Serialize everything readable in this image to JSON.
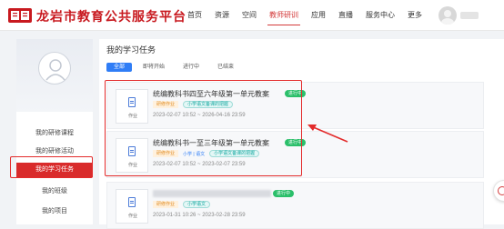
{
  "header": {
    "site_title": "龙岩市教育公共服务平台",
    "nav": [
      {
        "label": "首页"
      },
      {
        "label": "资源"
      },
      {
        "label": "空间"
      },
      {
        "label": "教师研训"
      },
      {
        "label": "应用"
      },
      {
        "label": "直播"
      },
      {
        "label": "服务中心"
      },
      {
        "label": "更多"
      }
    ],
    "active_nav": "教师研训",
    "accent_color": "#d33a3a",
    "icons": [
      "logo",
      "user-avatar"
    ]
  },
  "sidebar": {
    "items": [
      {
        "label": "我的研修课程"
      },
      {
        "label": "我的研修活动"
      },
      {
        "label": "我的学习任务"
      },
      {
        "label": "我的班级"
      },
      {
        "label": "我的项目"
      }
    ],
    "active_item": "我的学习任务",
    "active_color": "#d92b2b"
  },
  "main": {
    "title": "我的学习任务",
    "tabs": [
      {
        "label": "全部"
      },
      {
        "label": "即将开始"
      },
      {
        "label": "进行中"
      },
      {
        "label": "已结束"
      }
    ],
    "active_tab": "全部",
    "tab_active_color": "#2f7df6",
    "tasks": [
      {
        "thumb_label": "作业",
        "title": "统编教科书四至六年级第一单元教案",
        "status": "进行中",
        "type_tag": "研修作业",
        "subject_tag": "",
        "tag": "小学语文备课的把握",
        "date_range": "2023-02-07 10:52 ~ 2026-04-16 23:59"
      },
      {
        "thumb_label": "作业",
        "title": "统编教科书一至三年级第一单元教案",
        "status": "进行中",
        "type_tag": "研修作业",
        "subject_tag": "小学 | 语文",
        "tag": "小学语文备课的把握",
        "date_range": "2023-02-07 10:52 ~ 2023-02-07 23:59"
      },
      {
        "thumb_label": "作业",
        "title": "",
        "status": "进行中",
        "type_tag": "研修作业",
        "subject_tag": "",
        "tag": "小学语文",
        "date_range": "2023-01-31 10:26 ~ 2023-02-28 23:59"
      }
    ],
    "status_color": "#2bbf6a"
  },
  "annotation": {
    "box_color": "#e32b2b",
    "arrow_icon": "red-arrow-icon"
  }
}
